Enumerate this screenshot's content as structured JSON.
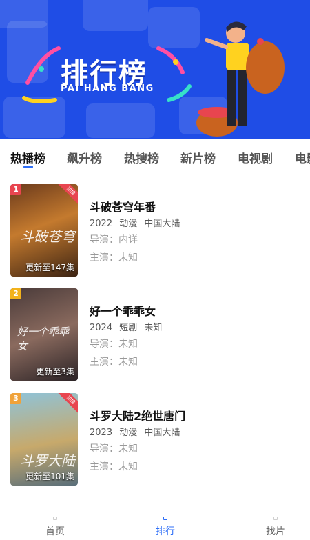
{
  "banner": {
    "title": "排行榜",
    "subtitle": "PAI HANG BANG"
  },
  "tabs": [
    {
      "label": "热播榜",
      "active": true
    },
    {
      "label": "飙升榜",
      "active": false
    },
    {
      "label": "热搜榜",
      "active": false
    },
    {
      "label": "新片榜",
      "active": false
    },
    {
      "label": "电视剧",
      "active": false
    },
    {
      "label": "电影",
      "active": false
    }
  ],
  "items": [
    {
      "rank": "1",
      "rank_color": "#e8454f",
      "ribbon": "热播",
      "poster_caption": "更新至147集",
      "poster_art": "斗破苍穹",
      "title": "斗破苍穹年番",
      "year": "2022",
      "genre": "动漫",
      "region": "中国大陆",
      "director": "导演：内详",
      "cast": "主演：未知"
    },
    {
      "rank": "2",
      "rank_color": "#f2b21b",
      "ribbon": "",
      "poster_caption": "更新至3集",
      "poster_art": "好一个乖乖女",
      "title": "好一个乖乖女",
      "year": "2024",
      "genre": "短剧",
      "region": "未知",
      "director": "导演：未知",
      "cast": "主演：未知"
    },
    {
      "rank": "3",
      "rank_color": "#f0a23a",
      "ribbon": "热播",
      "poster_caption": "更新至101集",
      "poster_art": "斗罗大陆",
      "title": "斗罗大陆2绝世唐门",
      "year": "2023",
      "genre": "动漫",
      "region": "中国大陆",
      "director": "导演：未知",
      "cast": "主演：未知"
    }
  ],
  "nav": [
    {
      "label": "首页",
      "active": false
    },
    {
      "label": "排行",
      "active": true
    },
    {
      "label": "找片",
      "active": false
    }
  ],
  "colors": {
    "accent": "#2d6ef7",
    "banner_bg": "#1f4de6"
  }
}
